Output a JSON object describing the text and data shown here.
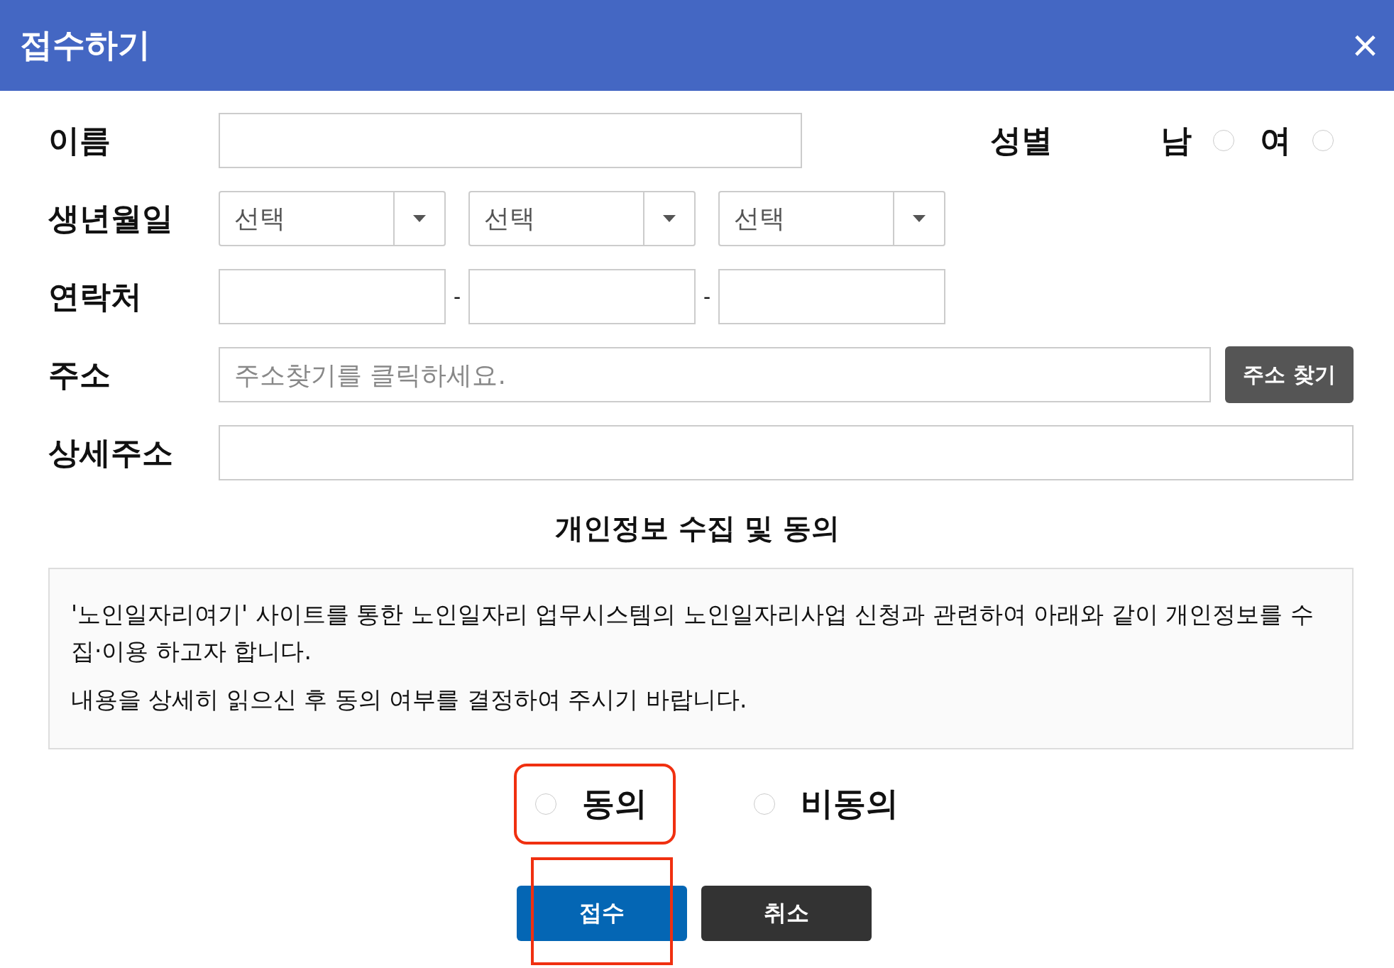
{
  "window": {
    "title": "접수하기",
    "close": "×"
  },
  "form": {
    "name": {
      "label": "이름"
    },
    "gender": {
      "label": "성별",
      "options": [
        {
          "label": "남",
          "selected": false
        },
        {
          "label": "여",
          "selected": false
        }
      ]
    },
    "birth": {
      "label": "생년월일",
      "selects": [
        {
          "value": "선택"
        },
        {
          "value": "선택"
        },
        {
          "value": "선택"
        }
      ]
    },
    "phone": {
      "label": "연락처",
      "separators": [
        "-",
        "-"
      ]
    },
    "address": {
      "label": "주소",
      "placeholder": "주소찾기를 클릭하세요.",
      "button": "주소 찾기"
    },
    "detail": {
      "label": "상세주소"
    }
  },
  "consent": {
    "title": "개인정보 수집 및 동의",
    "paragraphs": [
      "'노인일자리여기' 사이트를 통한 노인일자리 업무시스템의 노인일자리사업 신청과 관련하여 아래와 같이 개인정보를 수집·이용 하고자 합니다.",
      "내용을 상세히 읽으신 후 동의 여부를 결정하여 주시기 바랍니다."
    ],
    "options": [
      {
        "label": "동의",
        "selected": false,
        "highlighted": true
      },
      {
        "label": "비동의",
        "selected": false,
        "highlighted": false
      }
    ]
  },
  "buttons": [
    {
      "label": "접수",
      "kind": "primary",
      "highlighted": true
    },
    {
      "label": "취소",
      "kind": "secondary",
      "highlighted": false
    }
  ]
}
